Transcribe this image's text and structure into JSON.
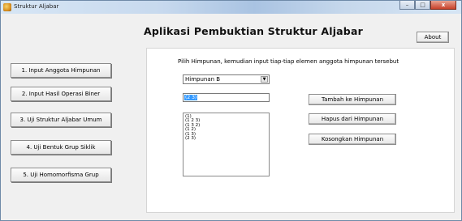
{
  "window": {
    "title": "Struktur Aljabar",
    "controls": {
      "minimize": "–",
      "maximize": "□",
      "close": "x"
    }
  },
  "app": {
    "title": "Aplikasi Pembuktian Struktur Aljabar",
    "about_label": "About"
  },
  "sidebar": {
    "items": [
      {
        "label": "1. Input Anggota Himpunan"
      },
      {
        "label": "2. Input Hasil Operasi Biner"
      },
      {
        "label": "3. Uji Struktur Aljabar Umum"
      },
      {
        "label": "4. Uji Bentuk Grup Siklik"
      },
      {
        "label": "5. Uji Homomorfisma Grup"
      }
    ]
  },
  "panel": {
    "instruction": "Pilih Himpunan, kemudian input tiap-tiap elemen anggota himpunan tersebut",
    "set_select": {
      "value": "Himpunan B",
      "arrow_icon": "chevron-down-icon"
    },
    "element_input": {
      "value": "(2 3)"
    },
    "elements": [
      "(1)",
      "(1 2 3)",
      "(1 3 2)",
      "(1 2)",
      "(1 3)",
      "(2 3)"
    ],
    "buttons": {
      "add": "Tambah ke Himpunan",
      "remove": "Hapus dari Himpunan",
      "clear": "Kosongkan Himpunan"
    }
  }
}
